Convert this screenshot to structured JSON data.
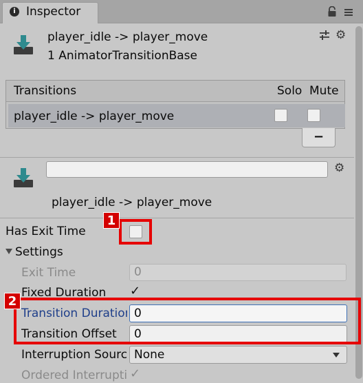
{
  "window": {
    "tab_title": "Inspector",
    "info_icon_glyph": "i",
    "tab_icons": [
      "lock-icon",
      "menu-icon"
    ]
  },
  "header": {
    "title": "player_idle -> player_move",
    "subtitle": "1 AnimatorTransitionBase",
    "icons": [
      "transition-icon",
      "preset-icon",
      "gear-icon"
    ]
  },
  "transitions": {
    "header_label": "Transitions",
    "solo_label": "Solo",
    "mute_label": "Mute",
    "rows": [
      {
        "label": "player_idle -> player_move",
        "solo": false,
        "mute": false
      }
    ],
    "remove_button_label": "−"
  },
  "transition_detail": {
    "name_value": "",
    "title": "player_idle -> player_move",
    "icons": [
      "transition-icon",
      "gear-icon"
    ]
  },
  "properties": {
    "has_exit_time": {
      "label": "Has Exit Time",
      "checked": false
    },
    "settings": {
      "label": "Settings",
      "expanded": true
    },
    "exit_time": {
      "label": "Exit Time",
      "value": "0",
      "enabled": false
    },
    "fixed_duration": {
      "label": "Fixed Duration",
      "checked": true,
      "check_glyph": "✓"
    },
    "transition_duration": {
      "label": "Transition Duration (s)",
      "value": "0"
    },
    "transition_offset": {
      "label": "Transition Offset",
      "value": "0"
    },
    "interruption_source": {
      "label": "Interruption Source",
      "value": "None"
    },
    "ordered_interruption": {
      "label": "Ordered Interruption",
      "checked": true,
      "enabled": false,
      "check_glyph": "✓"
    }
  },
  "annotations": [
    {
      "badge": "1",
      "target": "has-exit-time-checkbox"
    },
    {
      "badge": "2",
      "target": "transition-duration-and-offset-fields"
    }
  ],
  "colors": {
    "background": "#c8c8c8",
    "selected_row": "#aeb0b5",
    "annotation_red": "#e60000",
    "focused_label_blue": "#1f3f8a",
    "transition_icon_teal": "#2e8a8e"
  }
}
